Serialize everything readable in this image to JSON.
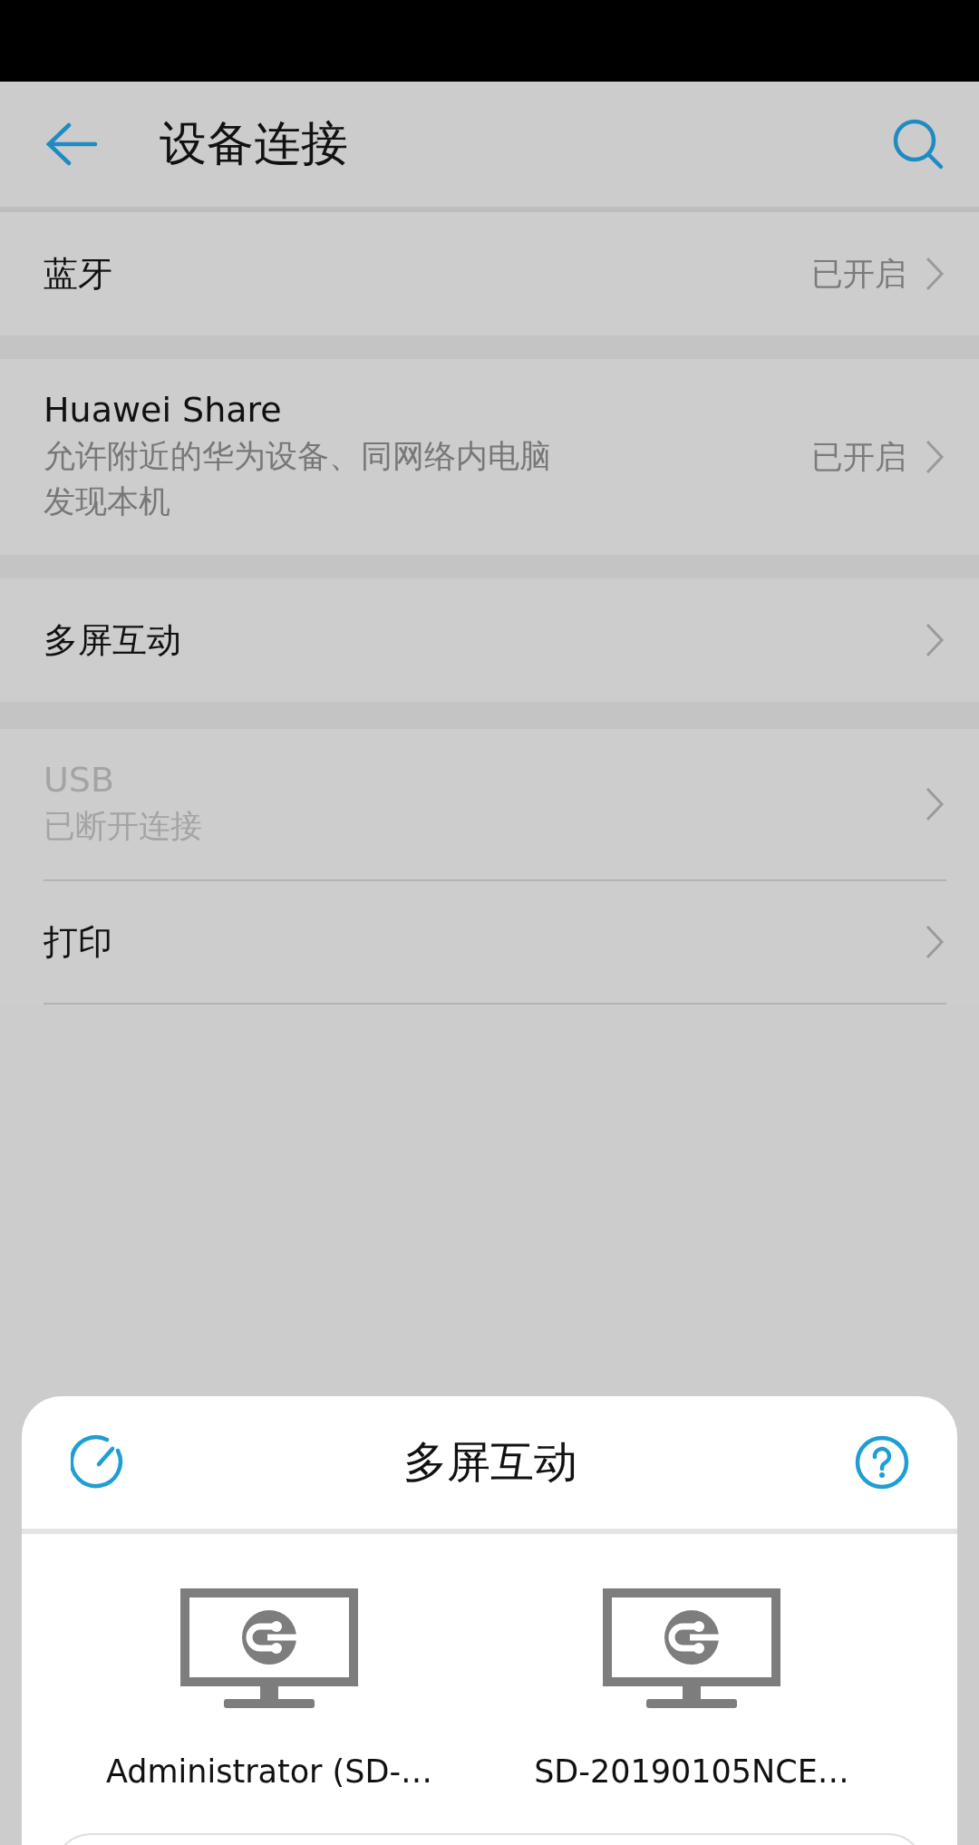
{
  "app_bar": {
    "title": "设备连接"
  },
  "groups": [
    {
      "rows": [
        {
          "title": "蓝牙",
          "status": "已开启",
          "disabled": false
        }
      ]
    },
    {
      "rows": [
        {
          "title": "Huawei Share",
          "subtitle": "允许附近的华为设备、同网络内电脑发现本机",
          "status": "已开启",
          "disabled": false
        }
      ]
    },
    {
      "rows": [
        {
          "title": "多屏互动",
          "disabled": false
        }
      ]
    },
    {
      "rows": [
        {
          "title": "USB",
          "subtitle": "已断开连接",
          "disabled": true
        },
        {
          "title": "打印",
          "disabled": false
        }
      ]
    }
  ],
  "sheet": {
    "title": "多屏互动",
    "devices": [
      {
        "name": "Administrator (SD-…"
      },
      {
        "name": "SD-20190105NCE…"
      }
    ]
  }
}
